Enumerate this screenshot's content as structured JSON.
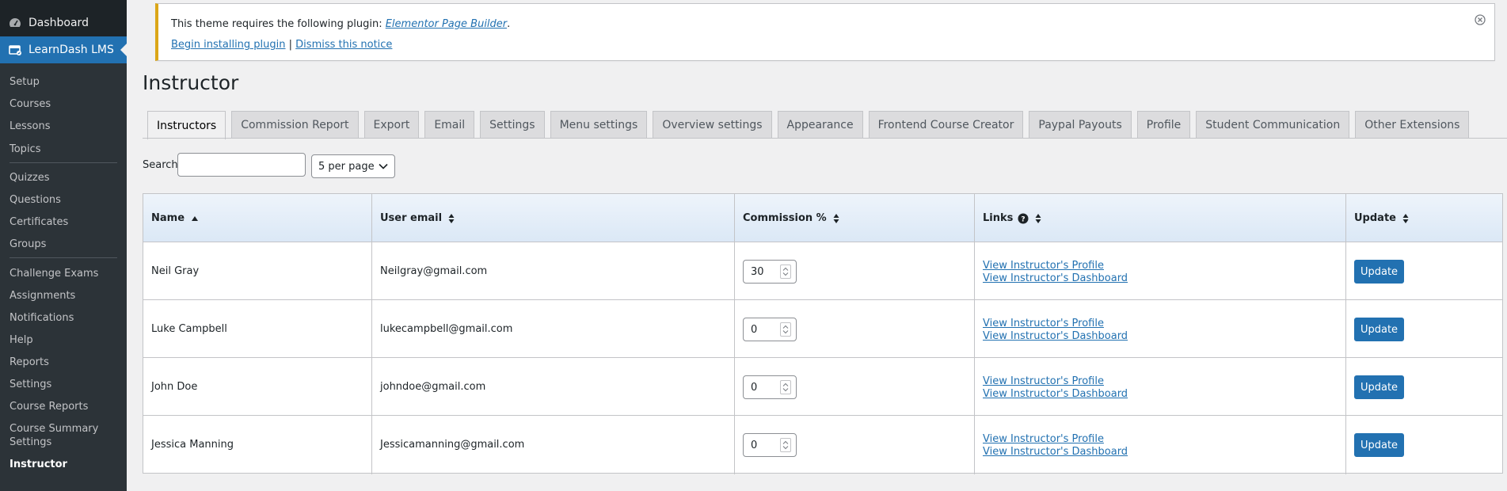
{
  "sidebar": {
    "dashboard": "Dashboard",
    "active_menu": "LearnDash LMS",
    "items": [
      {
        "label": "Setup"
      },
      {
        "label": "Courses"
      },
      {
        "label": "Lessons"
      },
      {
        "label": "Topics"
      },
      {
        "label": "Quizzes"
      },
      {
        "label": "Questions"
      },
      {
        "label": "Certificates"
      },
      {
        "label": "Groups"
      },
      {
        "label": "Challenge Exams"
      },
      {
        "label": "Assignments"
      },
      {
        "label": "Notifications"
      },
      {
        "label": "Help"
      },
      {
        "label": "Reports"
      },
      {
        "label": "Settings"
      },
      {
        "label": "Course Reports"
      },
      {
        "label": "Course Summary"
      },
      {
        "label": "Settings"
      },
      {
        "label": "Instructor"
      }
    ]
  },
  "notice": {
    "text": "This theme requires the following plugin: ",
    "plugin_link": "Elementor Page Builder",
    "period": ".",
    "install_link": "Begin installing plugin",
    "separator": " | ",
    "dismiss_link": "Dismiss this notice"
  },
  "page": {
    "title": "Instructor"
  },
  "tabs": [
    {
      "label": "Instructors"
    },
    {
      "label": "Commission Report"
    },
    {
      "label": "Export"
    },
    {
      "label": "Email"
    },
    {
      "label": "Settings"
    },
    {
      "label": "Menu settings"
    },
    {
      "label": "Overview settings"
    },
    {
      "label": "Appearance"
    },
    {
      "label": "Frontend Course Creator"
    },
    {
      "label": "Paypal Payouts"
    },
    {
      "label": "Profile"
    },
    {
      "label": "Student Communication"
    },
    {
      "label": "Other Extensions"
    }
  ],
  "search": {
    "label": "Search",
    "value": "",
    "per_page": "5 per page"
  },
  "table": {
    "headers": [
      "Name",
      "User email",
      "Commission %",
      "Links",
      "Update"
    ],
    "link_profile": "View Instructor's Profile",
    "link_dashboard": "View Instructor's Dashboard",
    "update_label": "Update",
    "rows": [
      {
        "name": "Neil Gray",
        "email": "Neilgray@gmail.com",
        "commission": "30"
      },
      {
        "name": "Luke Campbell",
        "email": "lukecampbell@gmail.com",
        "commission": "0"
      },
      {
        "name": "John Doe",
        "email": "johndoe@gmail.com",
        "commission": "0"
      },
      {
        "name": "Jessica Manning",
        "email": "Jessicamanning@gmail.com",
        "commission": "0"
      }
    ]
  },
  "colors": {
    "accent": "#2271b1",
    "sidebar_bg": "#1d2327",
    "submenu_bg": "#2c3338",
    "notice_warning": "#dba617"
  }
}
